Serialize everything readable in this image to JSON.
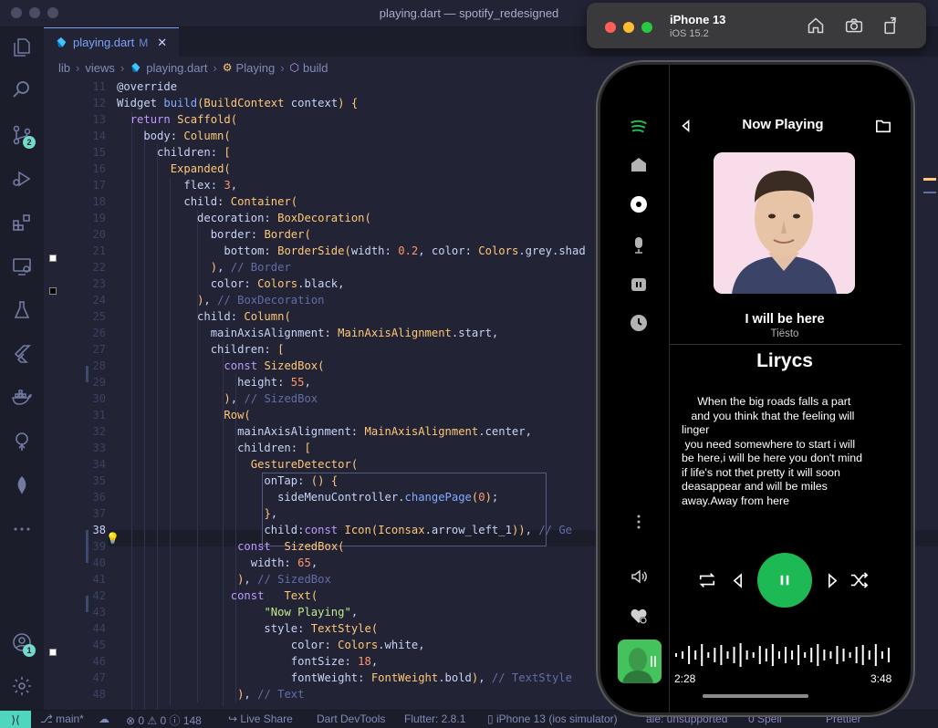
{
  "window": {
    "title": "playing.dart — spotify_redesigned"
  },
  "activity_bar": {
    "scm_badge": "2",
    "accounts_badge": "1"
  },
  "tab": {
    "name": "playing.dart",
    "modified": "M",
    "close": "✕"
  },
  "breadcrumb": {
    "items": [
      "lib",
      "views",
      "playing.dart",
      "Playing",
      "build"
    ]
  },
  "editor": {
    "lines": [
      {
        "n": "11",
        "code": "@override"
      },
      {
        "n": "12",
        "code": "Widget build(BuildContext context) {"
      },
      {
        "n": "13",
        "code": "  return Scaffold("
      },
      {
        "n": "14",
        "code": "    body: Column("
      },
      {
        "n": "15",
        "code": "      children: ["
      },
      {
        "n": "16",
        "code": "        Expanded("
      },
      {
        "n": "17",
        "code": "          flex: 3,"
      },
      {
        "n": "18",
        "code": "          child: Container("
      },
      {
        "n": "19",
        "code": "            decoration: BoxDecoration("
      },
      {
        "n": "20",
        "code": "              border: Border("
      },
      {
        "n": "21",
        "code": "                bottom: BorderSide(width: 0.2, color: Colors.grey.shad"
      },
      {
        "n": "22",
        "code": "              ), // Border"
      },
      {
        "n": "23",
        "code": "              color: Colors.black,"
      },
      {
        "n": "24",
        "code": "            ), // BoxDecoration"
      },
      {
        "n": "25",
        "code": "            child: Column("
      },
      {
        "n": "26",
        "code": "              mainAxisAlignment: MainAxisAlignment.start,"
      },
      {
        "n": "27",
        "code": "              children: ["
      },
      {
        "n": "28",
        "code": "                const SizedBox("
      },
      {
        "n": "29",
        "code": "                  height: 55,"
      },
      {
        "n": "30",
        "code": "                ), // SizedBox"
      },
      {
        "n": "31",
        "code": "                Row("
      },
      {
        "n": "32",
        "code": "                  mainAxisAlignment: MainAxisAlignment.center,"
      },
      {
        "n": "33",
        "code": "                  children: ["
      },
      {
        "n": "34",
        "code": "                    GestureDetector("
      },
      {
        "n": "35",
        "code": "                      onTap: () {"
      },
      {
        "n": "36",
        "code": "                        sideMenuController.changePage(0);"
      },
      {
        "n": "37",
        "code": "                      },"
      },
      {
        "n": "38",
        "code": "                      child:const Icon(Iconsax.arrow_left_1)), // Ge"
      },
      {
        "n": "39",
        "code": "                  const  SizedBox("
      },
      {
        "n": "40",
        "code": "                    width: 65,"
      },
      {
        "n": "41",
        "code": "                  ), // SizedBox"
      },
      {
        "n": "42",
        "code": "                 const   Text("
      },
      {
        "n": "43",
        "code": "                      \"Now Playing\","
      },
      {
        "n": "44",
        "code": "                      style: TextStyle("
      },
      {
        "n": "45",
        "code": "                          color: Colors.white,"
      },
      {
        "n": "46",
        "code": "                          fontSize: 18,"
      },
      {
        "n": "47",
        "code": "                          fontWeight: FontWeight.bold), // TextStyle"
      },
      {
        "n": "48",
        "code": "                  ), // Text"
      }
    ]
  },
  "status_bar": {
    "branch": "main*",
    "problems": "⊗ 0 ⚠ 0 ⓘ 148",
    "live_share": "Live Share",
    "devtools": "Dart DevTools",
    "flutter": "Flutter: 2.8.1",
    "device": "iPhone 13 (ios simulator)",
    "lang": "ale: unsupported",
    "spell": "0 Spell",
    "prettier": "Prettier"
  },
  "simulator": {
    "device": "iPhone 13",
    "os": "iOS 15.2"
  },
  "app": {
    "header_title": "Now Playing",
    "song_title": "I will be here",
    "artist": "Tiësto",
    "lyrics_heading": "Lirycs",
    "lyrics": "     When the big roads falls a part\n   and you think that the feeling will\nlinger\n you need somewhere to start i will\nbe here,i will be here you don't mind\nif life's not thet pretty it will soon\ndeasappear and will be miles\naway.Away from here",
    "elapsed": "2:28",
    "duration": "3:48",
    "accent": "#1db954"
  }
}
